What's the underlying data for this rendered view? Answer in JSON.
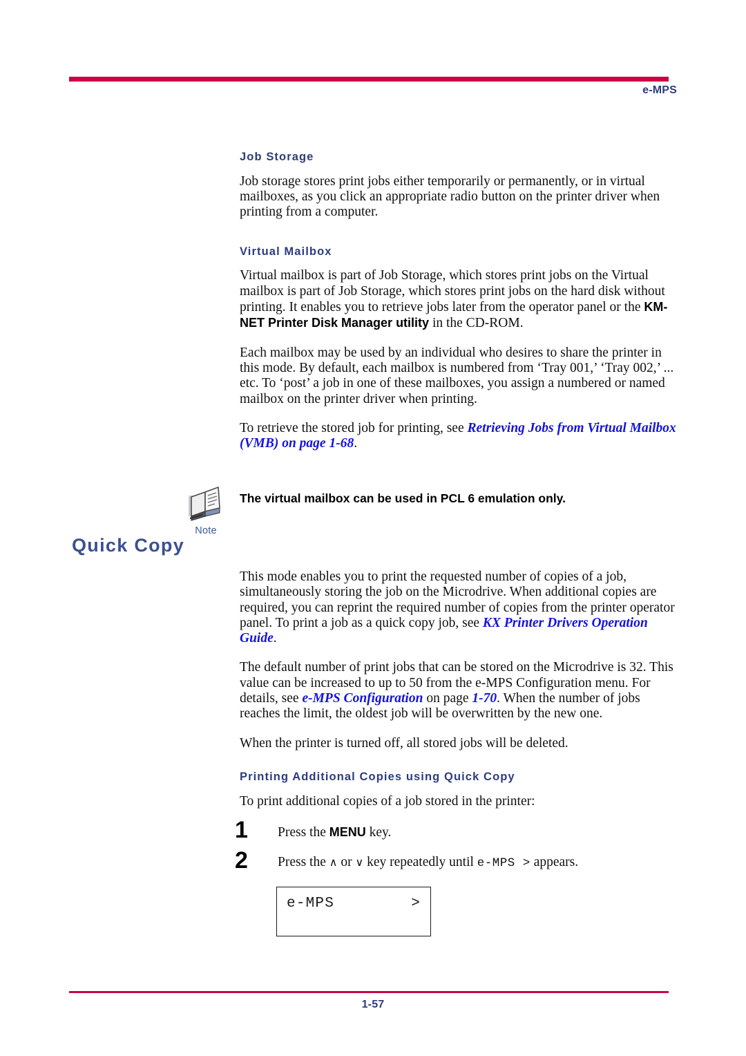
{
  "header": {
    "section_label": "e-MPS",
    "rule_color": "#CC0044"
  },
  "footer": {
    "page_number": "1-57",
    "rule_color": "#CC0044"
  },
  "colors": {
    "heading_blue": "#2C3C80",
    "chapter_blue": "#3B5090",
    "xref_blue": "#1414DC",
    "accent_crimson": "#CC0044"
  },
  "sections": {
    "job_storage": {
      "heading": "Job Storage",
      "paragraph": "Job storage stores print jobs either temporarily or permanently, or in virtual mailboxes, as you click an appropriate radio button on the printer driver when printing from a computer."
    },
    "virtual_mailbox": {
      "heading": "Virtual Mailbox",
      "paragraph1_part1": "Virtual mailbox is part of Job Storage, which stores print jobs on the Virtual mailbox is part of Job Storage, which stores print jobs on the hard disk without printing. It enables you to retrieve jobs later from the operator panel or the ",
      "paragraph1_bold": "KM-NET Printer Disk Manager utility",
      "paragraph1_part2": " in the CD-ROM.",
      "paragraph2": "Each mailbox may be used by an individual who desires to share the printer in this mode. By default, each mailbox is numbered from ‘Tray 001,’ ‘Tray 002,’ ... etc. To ‘post’ a job in one of these mailboxes, you assign a numbered or named mailbox on the printer driver when printing.",
      "paragraph3_prefix": "To retrieve the stored job for printing, see ",
      "paragraph3_xref": "Retrieving Jobs from Virtual Mailbox (VMB) on page 1-68",
      "paragraph3_suffix": "."
    }
  },
  "note": {
    "icon_name": "note-book-icon",
    "caption": "Note",
    "text": "The virtual mailbox can be used in PCL 6 emulation only."
  },
  "quick_copy": {
    "heading": "Quick Copy",
    "paragraph1_part1": "This mode enables you to print the requested number of copies of a job, simultaneously storing the job on the Microdrive. When additional copies are required, you can reprint the required number of copies from the printer operator panel. To print a job as a quick copy job, see ",
    "paragraph1_xref": "KX Printer Drivers Operation Guide",
    "paragraph1_part2": ".",
    "paragraph2_part1": "The default number of print jobs that can be stored on the Microdrive is 32. This value can be increased to up to 50 from the e-MPS Configuration menu. For details, see ",
    "paragraph2_xref1": "e-MPS Configuration",
    "paragraph2_mid": " on page ",
    "paragraph2_xref2": "1-70",
    "paragraph2_part2": ". When the number of jobs reaches the limit, the oldest job will be overwritten by the new one.",
    "paragraph3": "When the printer is turned off, all stored jobs will be deleted."
  },
  "procedure": {
    "heading": "Printing Additional Copies using Quick Copy",
    "intro": "To print additional copies of a job stored in the printer:",
    "steps": [
      {
        "number": "1",
        "text_part1": "Press the ",
        "key": "MENU",
        "text_part2": " key."
      },
      {
        "number": "2",
        "text_part1": "Press the ",
        "up_arrow": "∧",
        "text_mid": " or ",
        "down_arrow": "∨",
        "text_part2": " key repeatedly until ",
        "display_token": "e-MPS  >",
        "text_part3": " appears."
      }
    ]
  },
  "lcd_display": {
    "left_text": "e-MPS",
    "right_text": ">"
  }
}
